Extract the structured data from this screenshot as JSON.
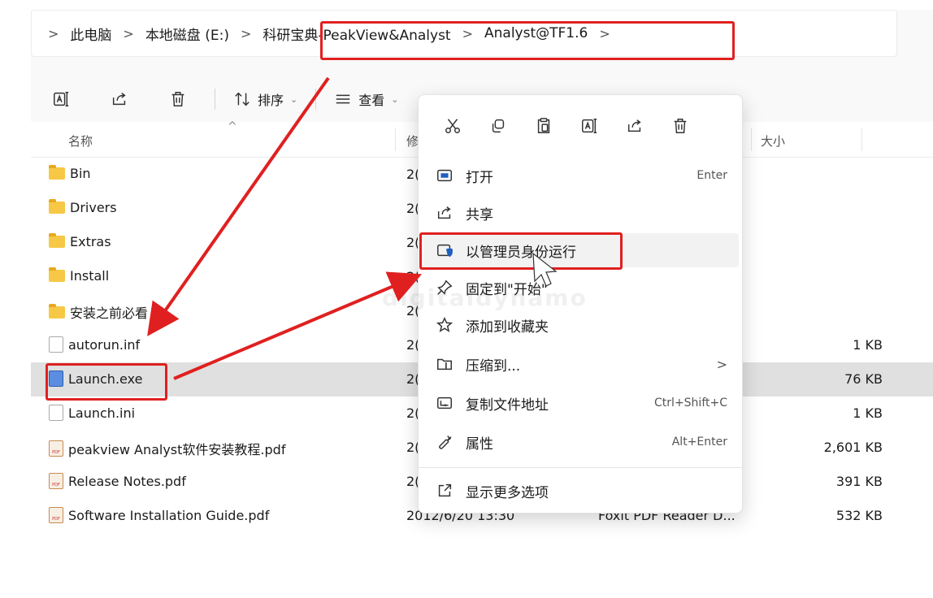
{
  "breadcrumb": {
    "items": [
      "此电脑",
      "本地磁盘 (E:)",
      "科研宝典-PeakView&Analyst",
      "Analyst@TF1.6"
    ],
    "separator": ">"
  },
  "toolbar": {
    "sort_label": "排序",
    "view_label": "查看"
  },
  "columns": {
    "name": "名称",
    "modified": "修",
    "size": "大小"
  },
  "rows": [
    {
      "name": "Bin",
      "type": "folder",
      "date": "2(",
      "kind": "",
      "size": ""
    },
    {
      "name": "Drivers",
      "type": "folder",
      "date": "2(",
      "kind": "",
      "size": ""
    },
    {
      "name": "Extras",
      "type": "folder",
      "date": "2(",
      "kind": "",
      "size": ""
    },
    {
      "name": "Install",
      "type": "folder",
      "date": "2(",
      "kind": "",
      "size": ""
    },
    {
      "name": "安装之前必看",
      "type": "folder",
      "date": "2(",
      "kind": "",
      "size": ""
    },
    {
      "name": "autorun.inf",
      "type": "file",
      "date": "2(",
      "kind": "",
      "size": "1 KB"
    },
    {
      "name": "Launch.exe",
      "type": "exe",
      "date": "2(",
      "kind": "",
      "size": "76 KB"
    },
    {
      "name": "Launch.ini",
      "type": "file",
      "date": "2(",
      "kind": "",
      "size": "1 KB"
    },
    {
      "name": "peakview Analyst软件安装教程.pdf",
      "type": "pdf",
      "date": "2(",
      "kind": "",
      "size": "2,601 KB"
    },
    {
      "name": "Release Notes.pdf",
      "type": "pdf",
      "date": "2(",
      "kind": "",
      "size": "391 KB"
    },
    {
      "name": "Software Installation Guide.pdf",
      "type": "pdf",
      "date": "2012/6/20 13:30",
      "kind": "Foxit PDF Reader D...",
      "size": "532 KB"
    }
  ],
  "context_menu": {
    "items": [
      {
        "label": "打开",
        "shortcut": "Enter"
      },
      {
        "label": "共享",
        "shortcut": ""
      },
      {
        "label": "以管理员身份运行",
        "shortcut": ""
      },
      {
        "label": "固定到\"开始\"",
        "shortcut": ""
      },
      {
        "label": "添加到收藏夹",
        "shortcut": ""
      },
      {
        "label": "压缩到...",
        "shortcut": ">"
      },
      {
        "label": "复制文件地址",
        "shortcut": "Ctrl+Shift+C"
      },
      {
        "label": "属性",
        "shortcut": "Alt+Enter"
      },
      {
        "label": "显示更多选项",
        "shortcut": ""
      }
    ]
  },
  "watermark": "digitaldynamo",
  "colors": {
    "highlight_red": "#e02020",
    "selected_row": "#e0e0e0",
    "folder": "#f6c845",
    "accent_blue": "#1f5fbf"
  }
}
